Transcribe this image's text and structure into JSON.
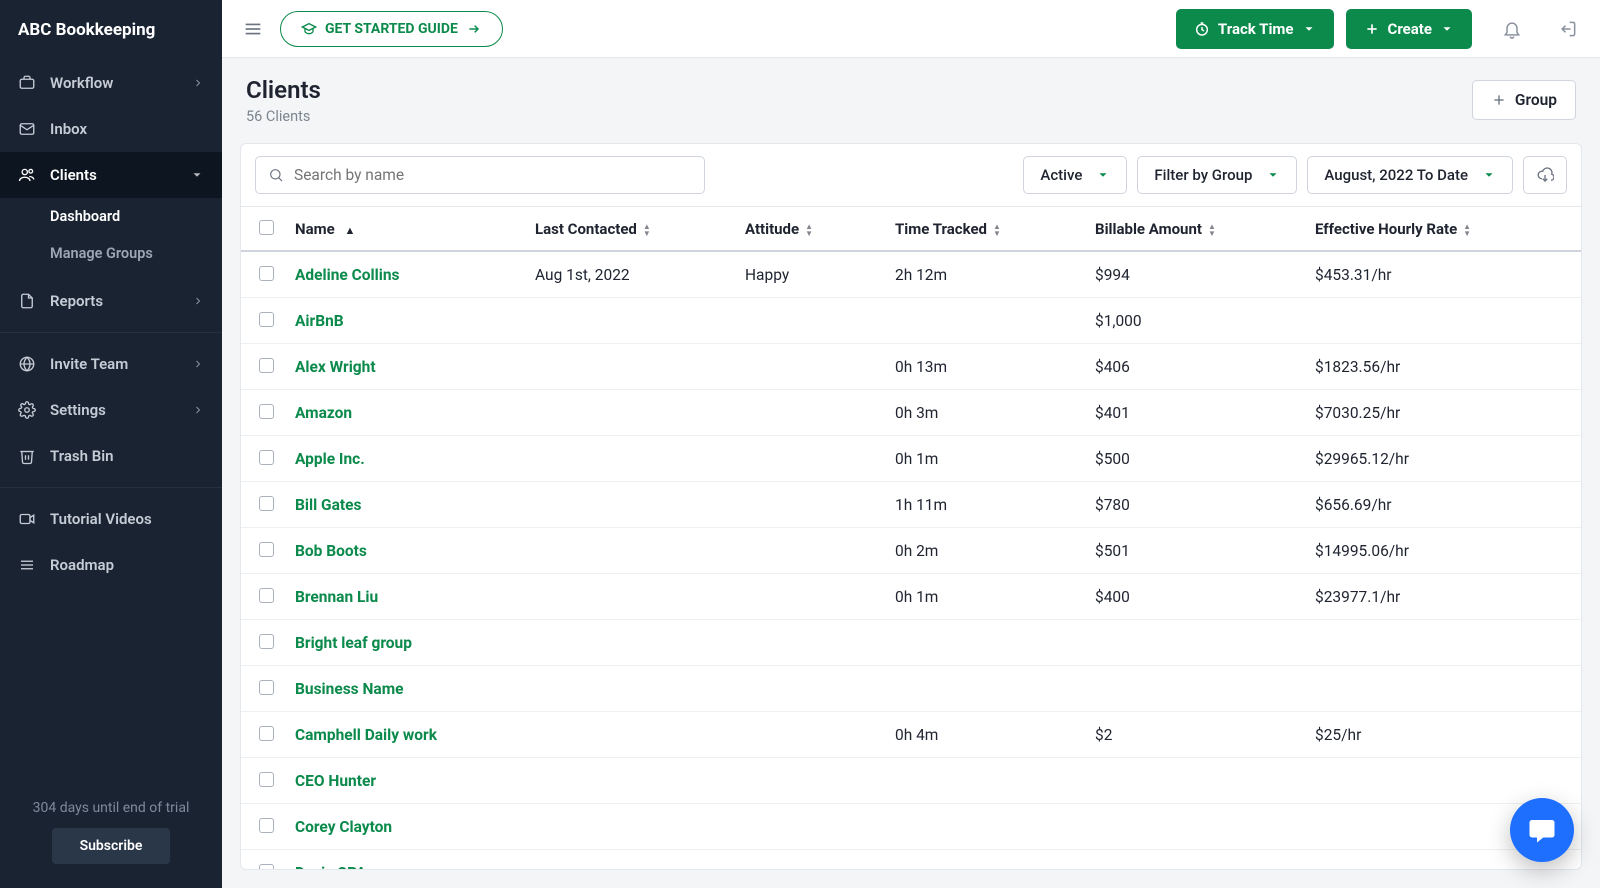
{
  "brand": "ABC Bookkeeping",
  "sidebar": {
    "workflow": "Workflow",
    "inbox": "Inbox",
    "clients": "Clients",
    "dashboard": "Dashboard",
    "manage_groups": "Manage Groups",
    "reports": "Reports",
    "invite_team": "Invite Team",
    "settings": "Settings",
    "trash": "Trash Bin",
    "tutorial": "Tutorial Videos",
    "roadmap": "Roadmap",
    "trial_text": "304 days until end of trial",
    "subscribe": "Subscribe"
  },
  "topbar": {
    "guide": "GET STARTED GUIDE",
    "track_time": "Track Time",
    "create": "Create"
  },
  "page": {
    "title": "Clients",
    "count": "56 Clients",
    "group_btn": "Group"
  },
  "filters": {
    "search_placeholder": "Search by name",
    "status": "Active",
    "group": "Filter by Group",
    "date": "August, 2022 To Date"
  },
  "columns": {
    "name": "Name",
    "last_contacted": "Last Contacted",
    "attitude": "Attitude",
    "time_tracked": "Time Tracked",
    "billable": "Billable Amount",
    "rate": "Effective Hourly Rate"
  },
  "rows": [
    {
      "name": "Adeline Collins",
      "contacted": "Aug 1st, 2022",
      "attitude": "Happy",
      "time": "2h 12m",
      "billable": "$994",
      "rate": "$453.31/hr"
    },
    {
      "name": "AirBnB",
      "contacted": "",
      "attitude": "",
      "time": "",
      "billable": "$1,000",
      "rate": ""
    },
    {
      "name": "Alex Wright",
      "contacted": "",
      "attitude": "",
      "time": "0h 13m",
      "billable": "$406",
      "rate": "$1823.56/hr"
    },
    {
      "name": "Amazon",
      "contacted": "",
      "attitude": "",
      "time": "0h 3m",
      "billable": "$401",
      "rate": "$7030.25/hr"
    },
    {
      "name": "Apple Inc.",
      "contacted": "",
      "attitude": "",
      "time": "0h 1m",
      "billable": "$500",
      "rate": "$29965.12/hr"
    },
    {
      "name": "Bill Gates",
      "contacted": "",
      "attitude": "",
      "time": "1h 11m",
      "billable": "$780",
      "rate": "$656.69/hr"
    },
    {
      "name": "Bob Boots",
      "contacted": "",
      "attitude": "",
      "time": "0h 2m",
      "billable": "$501",
      "rate": "$14995.06/hr"
    },
    {
      "name": "Brennan Liu",
      "contacted": "",
      "attitude": "",
      "time": "0h 1m",
      "billable": "$400",
      "rate": "$23977.1/hr"
    },
    {
      "name": "Bright leaf group",
      "contacted": "",
      "attitude": "",
      "time": "",
      "billable": "",
      "rate": ""
    },
    {
      "name": "Business Name",
      "contacted": "",
      "attitude": "",
      "time": "",
      "billable": "",
      "rate": ""
    },
    {
      "name": "Camphell Daily work",
      "contacted": "",
      "attitude": "",
      "time": "0h 4m",
      "billable": "$2",
      "rate": "$25/hr"
    },
    {
      "name": "CEO Hunter",
      "contacted": "",
      "attitude": "",
      "time": "",
      "billable": "",
      "rate": ""
    },
    {
      "name": "Corey Clayton",
      "contacted": "",
      "attitude": "",
      "time": "",
      "billable": "",
      "rate": ""
    },
    {
      "name": "Davis CPA",
      "contacted": "",
      "attitude": "",
      "time": "",
      "billable": "",
      "rate": ""
    }
  ]
}
